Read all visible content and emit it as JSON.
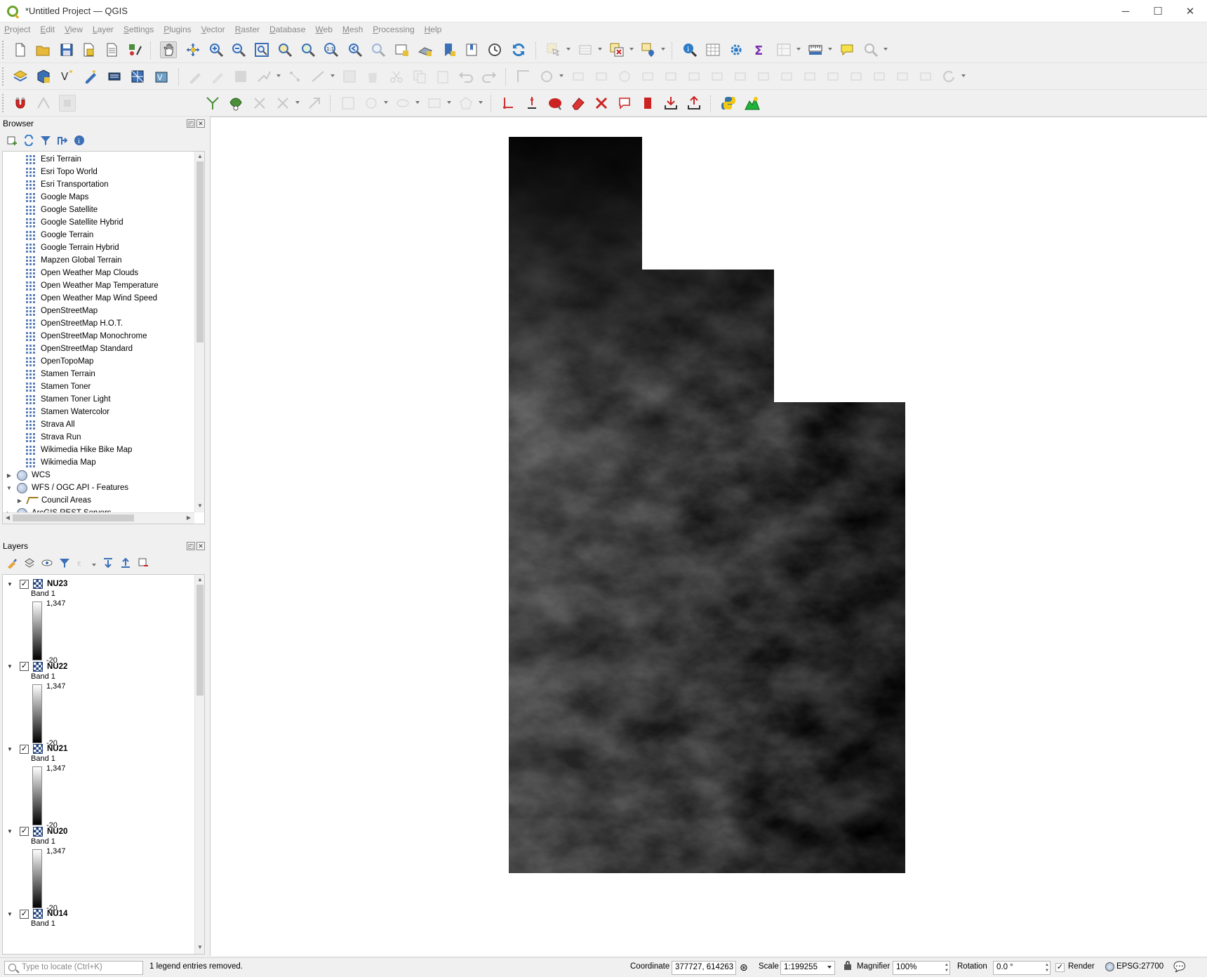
{
  "window": {
    "title": "*Untitled Project — QGIS",
    "controls": [
      "─",
      "☐",
      "✕"
    ]
  },
  "menu": [
    "Project",
    "Edit",
    "View",
    "Layer",
    "Settings",
    "Plugins",
    "Vector",
    "Raster",
    "Database",
    "Web",
    "Mesh",
    "Processing",
    "Help"
  ],
  "digitizing": {
    "tolerance": "12",
    "units": "px"
  },
  "browser": {
    "title": "Browser",
    "items": [
      {
        "label": "Esri Terrain",
        "kind": "tile"
      },
      {
        "label": "Esri Topo World",
        "kind": "tile"
      },
      {
        "label": "Esri Transportation",
        "kind": "tile"
      },
      {
        "label": "Google Maps",
        "kind": "tile"
      },
      {
        "label": "Google Satellite",
        "kind": "tile"
      },
      {
        "label": "Google Satellite Hybrid",
        "kind": "tile"
      },
      {
        "label": "Google Terrain",
        "kind": "tile"
      },
      {
        "label": "Google Terrain Hybrid",
        "kind": "tile"
      },
      {
        "label": "Mapzen Global Terrain",
        "kind": "tile"
      },
      {
        "label": "Open Weather Map Clouds",
        "kind": "tile"
      },
      {
        "label": "Open Weather Map Temperature",
        "kind": "tile"
      },
      {
        "label": "Open Weather Map Wind Speed",
        "kind": "tile"
      },
      {
        "label": "OpenStreetMap",
        "kind": "tile"
      },
      {
        "label": "OpenStreetMap H.O.T.",
        "kind": "tile"
      },
      {
        "label": "OpenStreetMap Monochrome",
        "kind": "tile"
      },
      {
        "label": "OpenStreetMap Standard",
        "kind": "tile"
      },
      {
        "label": "OpenTopoMap",
        "kind": "tile"
      },
      {
        "label": "Stamen Terrain",
        "kind": "tile"
      },
      {
        "label": "Stamen Toner",
        "kind": "tile"
      },
      {
        "label": "Stamen Toner Light",
        "kind": "tile"
      },
      {
        "label": "Stamen Watercolor",
        "kind": "tile"
      },
      {
        "label": "Strava All",
        "kind": "tile"
      },
      {
        "label": "Strava Run",
        "kind": "tile"
      },
      {
        "label": "Wikimedia Hike Bike Map",
        "kind": "tile"
      },
      {
        "label": "Wikimedia Map",
        "kind": "tile"
      },
      {
        "label": "WCS",
        "kind": "service",
        "expander": "▶"
      },
      {
        "label": "WFS / OGC API - Features",
        "kind": "service",
        "expander": "▼"
      },
      {
        "label": "Council Areas",
        "kind": "feature",
        "expander": "▶"
      },
      {
        "label": "ArcGIS REST Servers",
        "kind": "service",
        "expander": "▶"
      }
    ]
  },
  "layers": {
    "title": "Layers",
    "items": [
      {
        "name": "NU23",
        "band": "Band 1",
        "max": "1,347",
        "min": "-20",
        "checked": "✓"
      },
      {
        "name": "NU22",
        "band": "Band 1",
        "max": "1,347",
        "min": "-20",
        "checked": "✓"
      },
      {
        "name": "NU21",
        "band": "Band 1",
        "max": "1,347",
        "min": "-20",
        "checked": "✓"
      },
      {
        "name": "NU20",
        "band": "Band 1",
        "max": "1,347",
        "min": "-20",
        "checked": "✓"
      },
      {
        "name": "NU14",
        "band": "Band 1",
        "checked": "✓"
      }
    ]
  },
  "status": {
    "locator_placeholder": "Type to locate (Ctrl+K)",
    "message": "1 legend entries removed.",
    "coordinate_label": "Coordinate",
    "coordinate_value": "377727, 614263",
    "scale_label": "Scale",
    "scale_value": "1:199255",
    "magnifier_label": "Magnifier",
    "magnifier_value": "100%",
    "rotation_label": "Rotation",
    "rotation_value": "0.0 °",
    "render_label": "Render",
    "render_checked": "✓",
    "crs": "EPSG:27700"
  },
  "colors": {
    "accent": "#6ba32b",
    "raster_dark": "#000000",
    "raster_light": "#5a5a5a"
  }
}
